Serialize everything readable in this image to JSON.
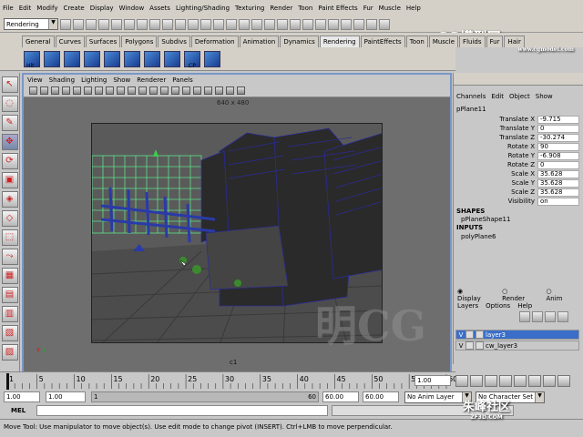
{
  "menubar": [
    "File",
    "Edit",
    "Modify",
    "Create",
    "Display",
    "Window",
    "Assets",
    "Lighting/Shading",
    "Texturing",
    "Render",
    "Toon",
    "Paint Effects",
    "Fur",
    "Muscle",
    "Help"
  ],
  "status": {
    "mode": "Rendering"
  },
  "shelf_tabs": [
    "General",
    "Curves",
    "Surfaces",
    "Polygons",
    "Subdivs",
    "Deformation",
    "Animation",
    "Dynamics",
    "Rendering",
    "PaintEffects",
    "Toon",
    "Muscle",
    "Fluids",
    "Fur",
    "Hair"
  ],
  "shelf_active": "Rendering",
  "shelf_labels": {
    "first": "Hlt",
    "cp": "CP"
  },
  "logo": {
    "main": "CG模型网",
    "url": "www.cgmodel.com"
  },
  "viewport": {
    "menu": [
      "View",
      "Shading",
      "Lighting",
      "Show",
      "Renderer",
      "Panels"
    ],
    "resolution": "640 x 480",
    "camera": "c1"
  },
  "channelbox": {
    "menu": [
      "Channels",
      "Edit",
      "Object",
      "Show"
    ],
    "object": "pPlane11",
    "attrs": [
      {
        "label": "Translate X",
        "value": "-9.715"
      },
      {
        "label": "Translate Y",
        "value": "0"
      },
      {
        "label": "Translate Z",
        "value": "-30.274"
      },
      {
        "label": "Rotate X",
        "value": "90"
      },
      {
        "label": "Rotate Y",
        "value": "-6.908"
      },
      {
        "label": "Rotate Z",
        "value": "0"
      },
      {
        "label": "Scale X",
        "value": "35.628"
      },
      {
        "label": "Scale Y",
        "value": "35.628"
      },
      {
        "label": "Scale Z",
        "value": "35.628"
      },
      {
        "label": "Visibility",
        "value": "on"
      }
    ],
    "shapes_label": "SHAPES",
    "shape": "pPlaneShape11",
    "inputs_label": "INPUTS",
    "input": "polyPlane6"
  },
  "layers": {
    "modes": [
      "Display",
      "Render",
      "Anim"
    ],
    "menu": [
      "Layers",
      "Options",
      "Help"
    ],
    "rows": [
      {
        "v": "V",
        "name": "layer3"
      },
      {
        "v": "V",
        "name": "cw_layer3"
      }
    ]
  },
  "timeline": {
    "ticks": [
      "1",
      "5",
      "10",
      "15",
      "20",
      "25",
      "30",
      "35",
      "40",
      "45",
      "50",
      "55",
      "60"
    ],
    "current": "1.00"
  },
  "range": {
    "start": "1.00",
    "start2": "1.00",
    "current": "1",
    "end": "60",
    "end2": "60.00",
    "end3": "60.00",
    "anim_layer": "No Anim Layer",
    "char_set": "No Character Set"
  },
  "mel": {
    "label": "MEL"
  },
  "help": "Move Tool: Use manipulator to move object(s). Use edit mode to change pivot (INSERT).  Ctrl+LMB to move perpendicular.",
  "watermarks": {
    "center": "明CG",
    "corner": "朱峰社区",
    "corner_url": "ZF3D.COM"
  },
  "colors": {
    "viewport_border": "#7a96c8",
    "selection_blue": "#3a6ec8"
  }
}
